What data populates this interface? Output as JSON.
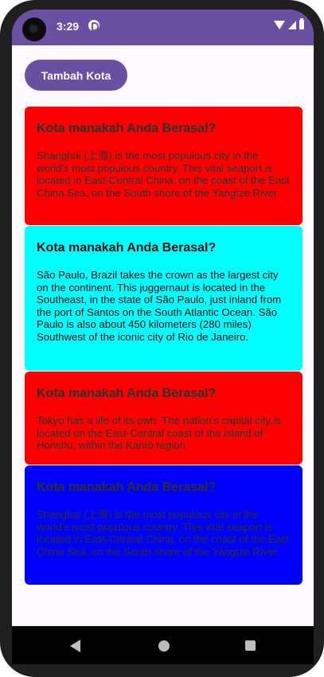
{
  "status_bar": {
    "time": "3:29"
  },
  "toolbar": {
    "add_city_label": "Tambah Kota"
  },
  "cards": [
    {
      "title": "Kota manakah Anda Berasal?",
      "body": "Shanghai (上海) is the most populous city in the world's most populous country. This vital seaport is located in East-Central China, on the coast of the East China Sea, on the South shore of the Yangtze River.",
      "color": "#ff0000"
    },
    {
      "title": "Kota manakah Anda Berasal?",
      "body": "São Paulo, Brazil takes the crown as the largest city on the continent. This juggernaut is located in the Southeast, in the state of São Paulo, just inland from the port of Santos on the South Atlantic Ocean. São Paulo is also about 450 kilometers (280 miles) Southwest of the iconic city of Rio de Janeiro.",
      "color": "#00ffff"
    },
    {
      "title": "Kota manakah Anda Berasal?",
      "body": "Tokyo has a life of its own. The nation's capital city is located on the East-Central coast of the island of Honshu, within the Kantō region.",
      "color": "#ff0000"
    },
    {
      "title": "Kota manakah Anda Berasal?",
      "body": "Shanghai (上海) is the most populous city in the world's most populous country. This vital seaport is located in East-Central China, on the coast of the East China Sea, on the South shore of the Yangtze River.",
      "color": "#0000ff"
    }
  ],
  "colors": {
    "accent": "#6a4fa3",
    "background": "#fdf9fe"
  }
}
